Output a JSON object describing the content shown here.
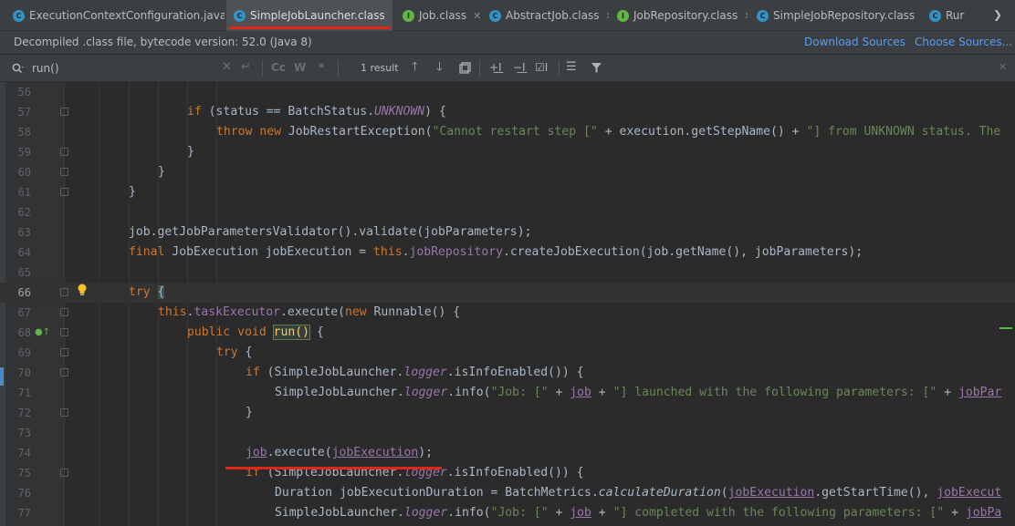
{
  "tabs": [
    {
      "label": "ExecutionContextConfiguration.java",
      "icon": "C",
      "icon_color": "#3592c4",
      "active": false
    },
    {
      "label": "SimpleJobLauncher.class",
      "icon": "C",
      "icon_color": "#3592c4",
      "active": true
    },
    {
      "label": "Job.class",
      "icon": "I",
      "icon_color": "#62b543",
      "active": false
    },
    {
      "label": "AbstractJob.class",
      "icon": "C",
      "icon_color": "#3592c4",
      "active": false
    },
    {
      "label": "JobRepository.class",
      "icon": "I",
      "icon_color": "#62b543",
      "active": false
    },
    {
      "label": "SimpleJobRepository.class",
      "icon": "C",
      "icon_color": "#3592c4",
      "active": false
    },
    {
      "label": "Rur",
      "icon": "C",
      "icon_color": "#3592c4",
      "active": false
    }
  ],
  "infobar": {
    "message": "Decompiled .class file, bytecode version: 52.0 (Java 8)",
    "download_sources": "Download Sources",
    "choose_sources": "Choose Sources..."
  },
  "find": {
    "query": "run()",
    "result_count": "1 result",
    "match_case": "Cc",
    "words": "W",
    "regex": "*"
  },
  "editor": {
    "current_line": 66,
    "lines": [
      {
        "n": "56",
        "fold": false
      },
      {
        "n": "57",
        "fold": true
      },
      {
        "n": "58",
        "fold": false
      },
      {
        "n": "59",
        "fold": true
      },
      {
        "n": "60",
        "fold": true
      },
      {
        "n": "61",
        "fold": true
      },
      {
        "n": "62",
        "fold": false
      },
      {
        "n": "63",
        "fold": false
      },
      {
        "n": "64",
        "fold": false
      },
      {
        "n": "65",
        "fold": false
      },
      {
        "n": "66",
        "fold": true
      },
      {
        "n": "67",
        "fold": true
      },
      {
        "n": "68",
        "fold": true
      },
      {
        "n": "69",
        "fold": true
      },
      {
        "n": "70",
        "fold": true
      },
      {
        "n": "71",
        "fold": false
      },
      {
        "n": "72",
        "fold": true
      },
      {
        "n": "73",
        "fold": false
      },
      {
        "n": "74",
        "fold": false
      },
      {
        "n": "75",
        "fold": true
      },
      {
        "n": "76",
        "fold": false
      },
      {
        "n": "77",
        "fold": false
      }
    ]
  },
  "code": {
    "l57": {
      "a": "if",
      "b": " (status == BatchStatus.",
      "c": "UNKNOWN",
      "d": ") {"
    },
    "l58": {
      "a": "throw",
      "b": " ",
      "c": "new",
      "d": " JobRestartException(",
      "e": "\"Cannot restart step [\"",
      "f": " + execution.getStepName() + ",
      "g": "\"] from UNKNOWN status. The"
    },
    "l59": "}",
    "l60": "}",
    "l61": "}",
    "l63": "job.getJobParametersValidator().validate(jobParameters);",
    "l64": {
      "a": "final",
      "b": " JobExecution jobExecution = ",
      "c": "this",
      "d": ".",
      "e": "jobRepository",
      "f": ".createJobExecution(job.getName(), jobParameters);"
    },
    "l66": {
      "a": "try",
      "b": " ",
      "c": "{"
    },
    "l67": {
      "a": "this",
      "b": ".",
      "c": "taskExecutor",
      "d": ".execute(",
      "e": "new",
      "f": " Runnable() {"
    },
    "l68": {
      "a": "public void",
      "b": " ",
      "c": "run()",
      "d": " {"
    },
    "l69": {
      "a": "try",
      "b": " {"
    },
    "l70": {
      "a": "if",
      "b": " (SimpleJobLauncher.",
      "c": "logger",
      "d": ".isInfoEnabled()) {"
    },
    "l71": {
      "a": "SimpleJobLauncher.",
      "b": "logger",
      "c": ".info(",
      "d": "\"Job: [\"",
      "e": " + ",
      "f": "job",
      "g": " + ",
      "h": "\"] launched with the following parameters: [\"",
      "i": " + ",
      "j": "jobPar"
    },
    "l72": "}",
    "l74": {
      "a": "job",
      "b": ".execute(",
      "c": "jobExecution",
      "d": ");"
    },
    "l75": {
      "a": "if",
      "b": " (SimpleJobLauncher.",
      "c": "logger",
      "d": ".isInfoEnabled()) {"
    },
    "l76": {
      "a": "Duration jobExecutionDuration = BatchMetrics.",
      "b": "calculateDuration",
      "c": "(",
      "d": "jobExecution",
      "e": ".getStartTime(), ",
      "f": "jobExecut"
    },
    "l77": {
      "a": "SimpleJobLauncher.",
      "b": "logger",
      "c": ".info(",
      "d": "\"Job: [\"",
      "e": " + ",
      "f": "job",
      "g": " + ",
      "h": "\"] completed with the following parameters: [\"",
      "i": " + ",
      "j": "jobPa"
    }
  }
}
